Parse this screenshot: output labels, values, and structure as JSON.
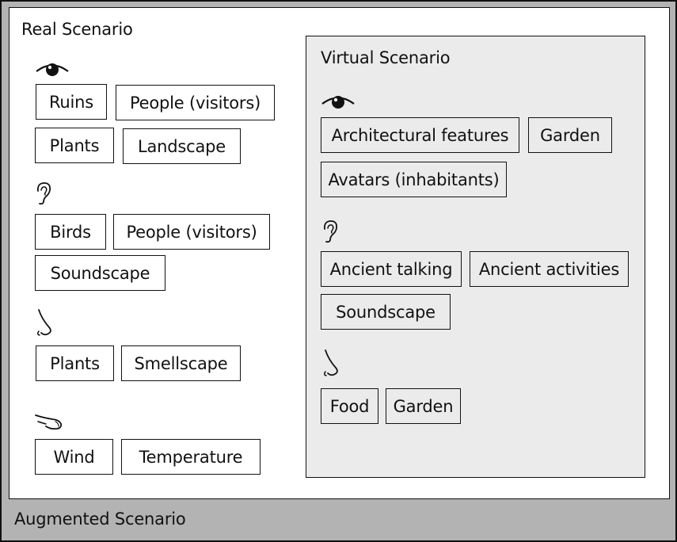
{
  "augmented": {
    "title": "Augmented Scenario"
  },
  "real": {
    "title": "Real Scenario",
    "sight": [
      "Ruins",
      "People (visitors)",
      "Plants",
      "Landscape"
    ],
    "hearing": [
      "Birds",
      "People (visitors)",
      "Soundscape"
    ],
    "smell": [
      "Plants",
      "Smellscape"
    ],
    "touch": [
      "Wind",
      "Temperature"
    ]
  },
  "virtual": {
    "title": "Virtual Scenario",
    "sight": [
      "Architectural features",
      "Garden",
      "Avatars (inhabitants)"
    ],
    "hearing": [
      "Ancient talking",
      "Ancient activities",
      "Soundscape"
    ],
    "smell": [
      "Food",
      "Garden"
    ]
  },
  "icons": {
    "sight": "eye-icon",
    "hearing": "ear-icon",
    "smell": "nose-icon",
    "touch": "hand-icon"
  }
}
